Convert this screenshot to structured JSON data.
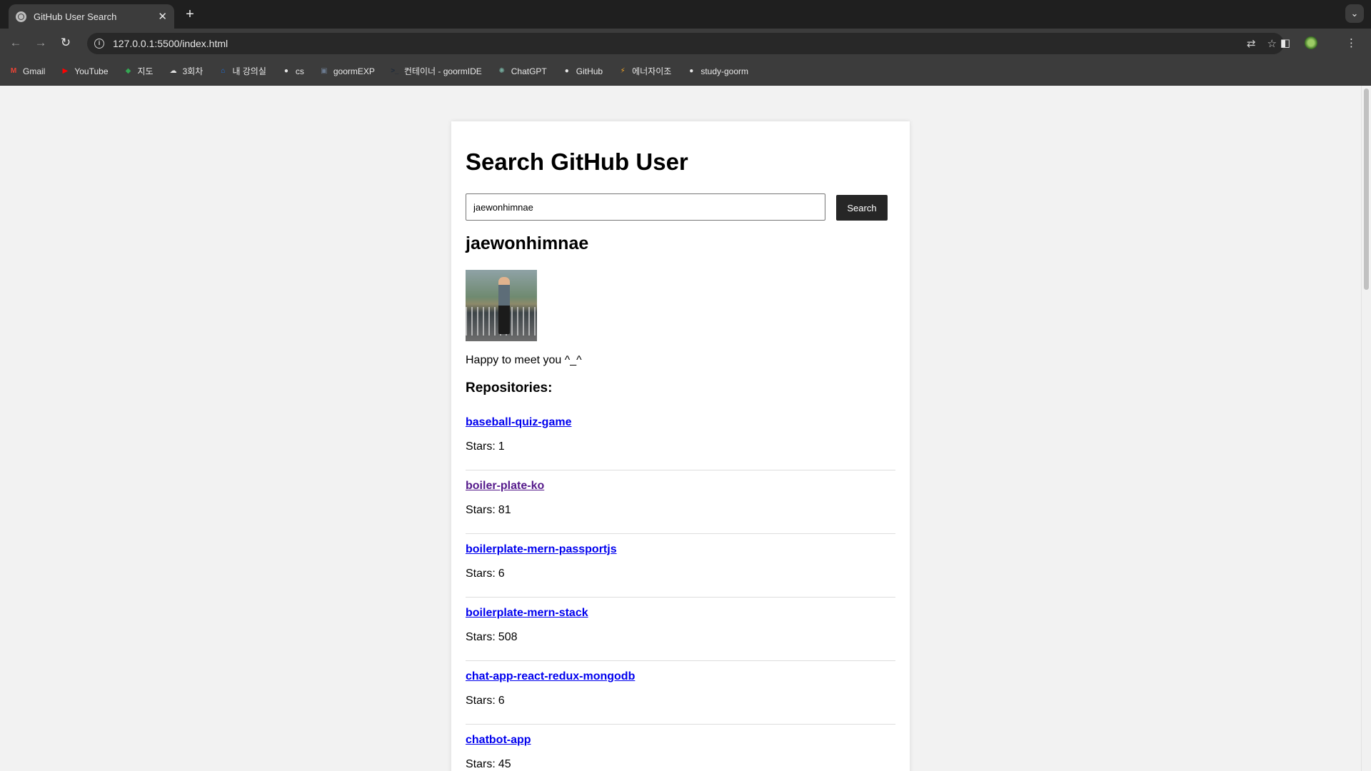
{
  "browser": {
    "tab_title": "GitHub User Search",
    "tab_close": "✕",
    "new_tab": "+",
    "url": "127.0.0.1:5500/index.html"
  },
  "bookmarks": [
    {
      "label": "Gmail",
      "icon": "gmail-icon",
      "color": "#ea4335",
      "glyph": "M"
    },
    {
      "label": "YouTube",
      "icon": "youtube-icon",
      "color": "#ff0000",
      "glyph": "▶"
    },
    {
      "label": "지도",
      "icon": "maps-icon",
      "color": "#34a853",
      "glyph": "◆"
    },
    {
      "label": "3회차",
      "icon": "cloud-icon",
      "color": "#e0e0e0",
      "glyph": "☁"
    },
    {
      "label": "내 강의실",
      "icon": "home-icon",
      "color": "#1a73e8",
      "glyph": "⌂"
    },
    {
      "label": "cs",
      "icon": "github-icon",
      "color": "#e8e8e8",
      "glyph": "●"
    },
    {
      "label": "goormEXP",
      "icon": "goorm-icon",
      "color": "#6b7a8f",
      "glyph": "▣"
    },
    {
      "label": "컨테이너 - goormIDE",
      "icon": "terminal-icon",
      "color": "#1e2a3a",
      "glyph": ">_"
    },
    {
      "label": "ChatGPT",
      "icon": "chatgpt-icon",
      "color": "#74aa9c",
      "glyph": "✺"
    },
    {
      "label": "GitHub",
      "icon": "github-icon",
      "color": "#e8e8e8",
      "glyph": "●"
    },
    {
      "label": "에너자이조",
      "icon": "lightning-icon",
      "color": "#f9a825",
      "glyph": "⚡"
    },
    {
      "label": "study-goorm",
      "icon": "github-icon",
      "color": "#e8e8e8",
      "glyph": "●"
    }
  ],
  "page": {
    "title": "Search GitHub User",
    "search_value": "jaewonhimnae",
    "search_button": "Search",
    "user_name": "jaewonhimnae",
    "avatar_alt": "avatar",
    "bio": "Happy to meet you ^_^",
    "repo_heading": "Repositories:",
    "stars_label": "Stars:"
  },
  "repos": [
    {
      "name": "baseball-quiz-game",
      "stars": "1",
      "visited": false
    },
    {
      "name": "boiler-plate-ko",
      "stars": "81",
      "visited": true
    },
    {
      "name": "boilerplate-mern-passportjs",
      "stars": "6",
      "visited": false
    },
    {
      "name": "boilerplate-mern-stack",
      "stars": "508",
      "visited": false
    },
    {
      "name": "chat-app-react-redux-mongodb",
      "stars": "6",
      "visited": false
    },
    {
      "name": "chatbot-app",
      "stars": "45",
      "visited": false
    }
  ],
  "colors": {
    "link": "#0000ee",
    "link_visited": "#551a8b",
    "button_bg": "#262626",
    "page_bg": "#f2f2f2"
  }
}
